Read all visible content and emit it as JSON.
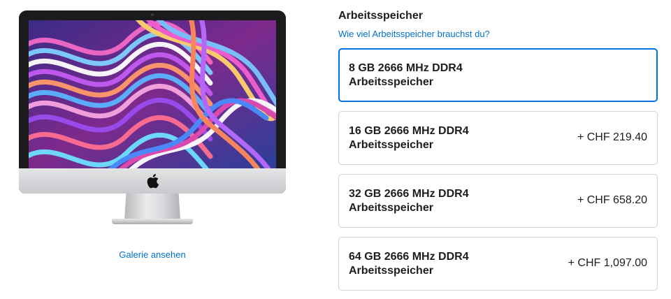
{
  "product": {
    "gallery_link": "Galerie ansehen"
  },
  "memory": {
    "title": "Arbeitsspeicher",
    "help_link": "Wie viel Arbeitsspeicher brauchst du?",
    "options": [
      {
        "name": "8 GB 2666 MHz DDR4",
        "sub": "Arbeitsspeicher",
        "price": "",
        "selected": true
      },
      {
        "name": "16 GB 2666 MHz DDR4",
        "sub": "Arbeitsspeicher",
        "price": "+ CHF 219.40",
        "selected": false
      },
      {
        "name": "32 GB 2666 MHz DDR4",
        "sub": "Arbeitsspeicher",
        "price": "+ CHF 658.20",
        "selected": false
      },
      {
        "name": "64 GB 2666 MHz DDR4",
        "sub": "Arbeitsspeicher",
        "price": "+ CHF 1,097.00",
        "selected": false
      }
    ]
  },
  "colors": {
    "accent": "#0071e3",
    "link": "#0070c9",
    "border": "#d2d2d7",
    "text": "#1d1d1f"
  }
}
